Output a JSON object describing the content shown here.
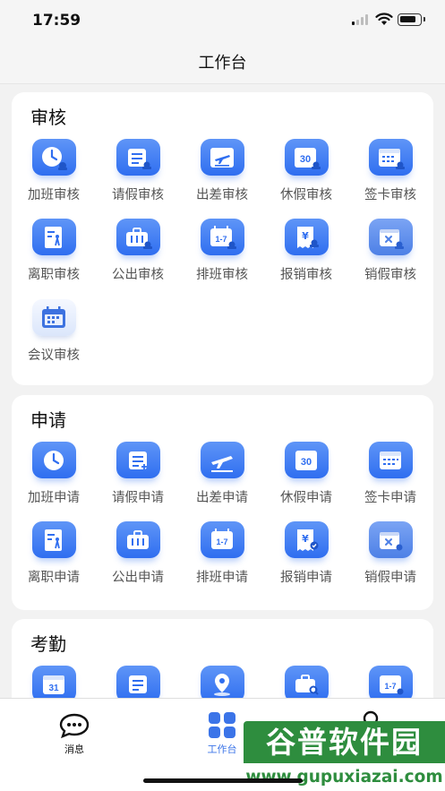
{
  "status_bar": {
    "time": "17:59"
  },
  "nav": {
    "title": "工作台"
  },
  "sections": {
    "review": {
      "title": "审核",
      "items": [
        "加班审核",
        "请假审核",
        "出差审核",
        "休假审核",
        "签卡审核",
        "离职审核",
        "公出审核",
        "排班审核",
        "报销审核",
        "销假审核",
        "会议审核"
      ]
    },
    "apply": {
      "title": "申请",
      "items": [
        "加班申请",
        "请假申请",
        "出差申请",
        "休假申请",
        "签卡申请",
        "离职申请",
        "公出申请",
        "排班申请",
        "报销申请",
        "销假申请"
      ]
    },
    "attendance": {
      "title": "考勤"
    }
  },
  "icon_text": {
    "thirty": "30",
    "one_to_seven": "1-7",
    "thirty_one": "31",
    "yen": "¥"
  },
  "tab_bar": {
    "messages": {
      "label": "消息"
    },
    "workbench": {
      "label": "工作台"
    }
  },
  "watermark": {
    "brand": "谷普软件园",
    "url": "www.gupuxiazai.com"
  },
  "colors": {
    "accent": "#3b74e8",
    "tile_gradient_top": "#5f95f7",
    "tile_gradient_bottom": "#2f6ef0",
    "watermark_green": "#2e8d3e"
  }
}
